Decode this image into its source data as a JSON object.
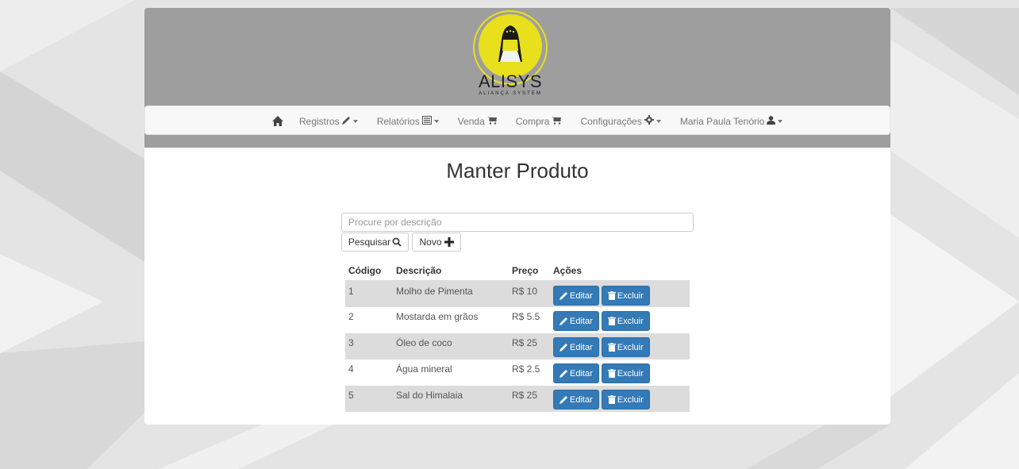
{
  "colors": {
    "header_bg": "#9e9e9e",
    "logo_yellow": "#e8e01c",
    "primary": "#337ab7"
  },
  "brand": {
    "name": "ALISYS",
    "tagline": "ALIANÇA SYSTEM"
  },
  "nav": {
    "home_icon": "home-icon",
    "items": [
      {
        "label": "Registros",
        "icon": "pencil-icon",
        "dropdown": true
      },
      {
        "label": "Relatórios",
        "icon": "list-alt-icon",
        "dropdown": true
      },
      {
        "label": "Venda",
        "icon": "cart-icon",
        "dropdown": false
      },
      {
        "label": "Compra",
        "icon": "cart-icon",
        "dropdown": false
      },
      {
        "label": "Configurações",
        "icon": "cog-icon",
        "dropdown": true
      },
      {
        "label": "Maria Paula Tenório",
        "icon": "user-icon",
        "dropdown": true
      }
    ]
  },
  "page": {
    "title": "Manter Produto"
  },
  "search": {
    "placeholder": "Procure por descrição",
    "value": "",
    "search_button": "Pesquisar",
    "new_button": "Novo"
  },
  "table": {
    "headers": [
      "Código",
      "Descrição",
      "Preço",
      "Ações"
    ],
    "edit_label": "Editar",
    "delete_label": "Excluir",
    "rows": [
      {
        "codigo": "1",
        "descricao": "Molho de Pimenta",
        "preco": "R$ 10"
      },
      {
        "codigo": "2",
        "descricao": "Mostarda em grãos",
        "preco": "R$ 5.5"
      },
      {
        "codigo": "3",
        "descricao": "Óleo de coco",
        "preco": "R$ 25"
      },
      {
        "codigo": "4",
        "descricao": "Água mineral",
        "preco": "R$ 2.5"
      },
      {
        "codigo": "5",
        "descricao": "Sal do Himalaia",
        "preco": "R$ 25"
      }
    ]
  }
}
